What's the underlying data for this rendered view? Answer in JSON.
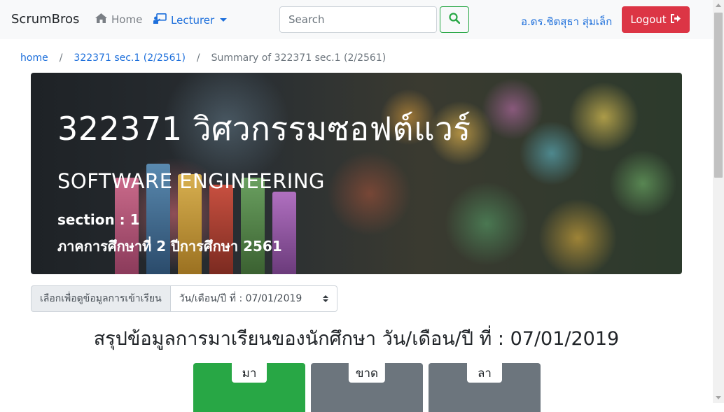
{
  "navbar": {
    "brand": "ScrumBros",
    "home_label": "Home",
    "lecturer_label": "Lecturer",
    "search_placeholder": "Search",
    "user_name": "อ.ดร.ชิตสุธา สุ่มเล็ก",
    "logout_label": "Logout"
  },
  "breadcrumb": {
    "items": [
      "home",
      "322371 sec.1 (2/2561)",
      "Summary of 322371 sec.1 (2/2561)"
    ],
    "separator": "/"
  },
  "banner": {
    "title": "322371 วิศวกรรมซอฟต์แวร์",
    "english_name": "SOFTWARE ENGINEERING",
    "section": "section : 1",
    "term": "ภาคการศึกษาที่ 2 ปีการศึกษา 2561"
  },
  "date_selector": {
    "label": "เลือกเพื่อดูข้อมูลการเข้าเรียน",
    "selected": "วัน/เดือน/ปี ที่ : 07/01/2019"
  },
  "summary": {
    "heading": "สรุปข้อมูลการมาเรียนของนักศึกษา วัน/เดือน/ปี ที่ : 07/01/2019"
  },
  "status_cards": [
    {
      "label": "มา",
      "color": "#28a745"
    },
    {
      "label": "ขาด",
      "color": "#6c757d"
    },
    {
      "label": "ลา",
      "color": "#6c757d"
    }
  ],
  "colors": {
    "link": "#1d6fdb",
    "danger": "#dc3545",
    "success": "#28a745",
    "secondary": "#6c757d"
  }
}
